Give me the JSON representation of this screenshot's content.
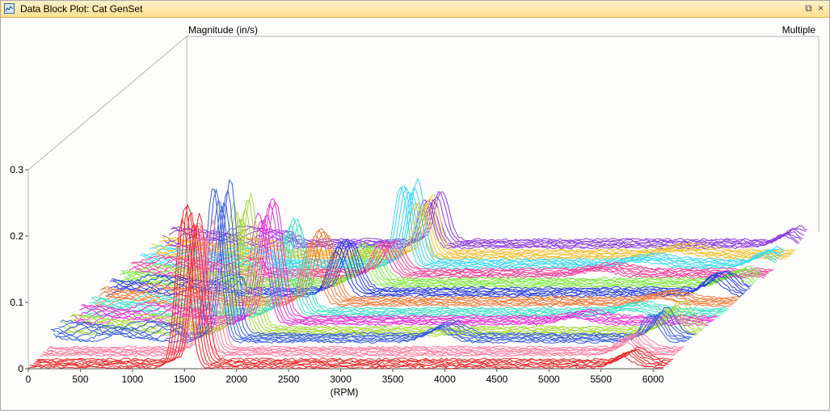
{
  "window": {
    "title": "Data Block Plot: Cat GenSet",
    "restore_glyph": "⧉",
    "close_glyph": "×"
  },
  "chart_data": {
    "type": "waterfall-3d-line",
    "title": "",
    "ylabel": "Magnitude (in/s)",
    "xlabel": "(RPM)",
    "corner_label": "Multiple",
    "xlim": [
      0,
      6100
    ],
    "ylim": [
      0,
      0.3
    ],
    "x_ticks": [
      0,
      500,
      1000,
      1500,
      2000,
      2500,
      3000,
      3500,
      4000,
      4500,
      5000,
      5500,
      6000
    ],
    "y_ticks": [
      {
        "value": 0,
        "label": "0"
      },
      {
        "value": 0.1,
        "label": "0.1"
      },
      {
        "value": 0.2,
        "label": "0.2"
      },
      {
        "value": 0.3,
        "label": "0.3"
      }
    ],
    "grid": false,
    "groups": [
      {
        "color": "#e8282a",
        "baseline": 0.002,
        "peaks": [
          [
            1480,
            0.245,
            110
          ],
          [
            5700,
            0.02,
            140
          ]
        ]
      },
      {
        "color": "#ff7fa0",
        "baseline": 0.006,
        "peaks": [
          [
            1500,
            0.2,
            110
          ],
          [
            5600,
            0.025,
            140
          ]
        ]
      },
      {
        "color": "#3a5fe0",
        "baseline": 0.012,
        "peaks": [
          [
            1560,
            0.235,
            110
          ],
          [
            3700,
            0.02,
            200
          ],
          [
            5750,
            0.04,
            140
          ]
        ]
      },
      {
        "color": "#a5d93b",
        "baseline": 0.008,
        "peaks": [
          [
            1650,
            0.2,
            120
          ],
          [
            5800,
            0.04,
            160
          ]
        ]
      },
      {
        "color": "#e830d8",
        "baseline": 0.01,
        "peaks": [
          [
            1780,
            0.18,
            130
          ],
          [
            4800,
            0.01,
            250
          ]
        ]
      },
      {
        "color": "#3fe0c8",
        "baseline": 0.008,
        "peaks": [
          [
            1900,
            0.14,
            130
          ],
          [
            5200,
            0.01,
            250
          ]
        ]
      },
      {
        "color": "#f07b3a",
        "baseline": 0.01,
        "peaks": [
          [
            2060,
            0.11,
            140
          ],
          [
            5400,
            0.012,
            250
          ]
        ]
      },
      {
        "color": "#2a3ee0",
        "baseline": 0.01,
        "peaks": [
          [
            2200,
            0.08,
            140
          ],
          [
            5800,
            0.03,
            180
          ]
        ]
      },
      {
        "color": "#7de840",
        "baseline": 0.01,
        "peaks": [
          [
            2300,
            0.06,
            140
          ],
          [
            5900,
            0.02,
            180
          ]
        ]
      },
      {
        "color": "#f0409a",
        "baseline": 0.01,
        "peaks": [
          [
            2400,
            0.05,
            140
          ],
          [
            4500,
            0.01,
            300
          ]
        ]
      },
      {
        "color": "#3ad8f0",
        "baseline": 0.01,
        "peaks": [
          [
            2500,
            0.125,
            110
          ],
          [
            4800,
            0.01,
            300
          ],
          [
            5950,
            0.02,
            180
          ]
        ]
      },
      {
        "color": "#f0c030",
        "baseline": 0.01,
        "peaks": [
          [
            2540,
            0.085,
            110
          ],
          [
            5000,
            0.01,
            300
          ]
        ]
      },
      {
        "color": "#8a3ae0",
        "baseline": 0.012,
        "peaks": [
          [
            2520,
            0.075,
            110
          ],
          [
            5950,
            0.02,
            160
          ]
        ]
      }
    ],
    "curves_per_group": 7
  }
}
